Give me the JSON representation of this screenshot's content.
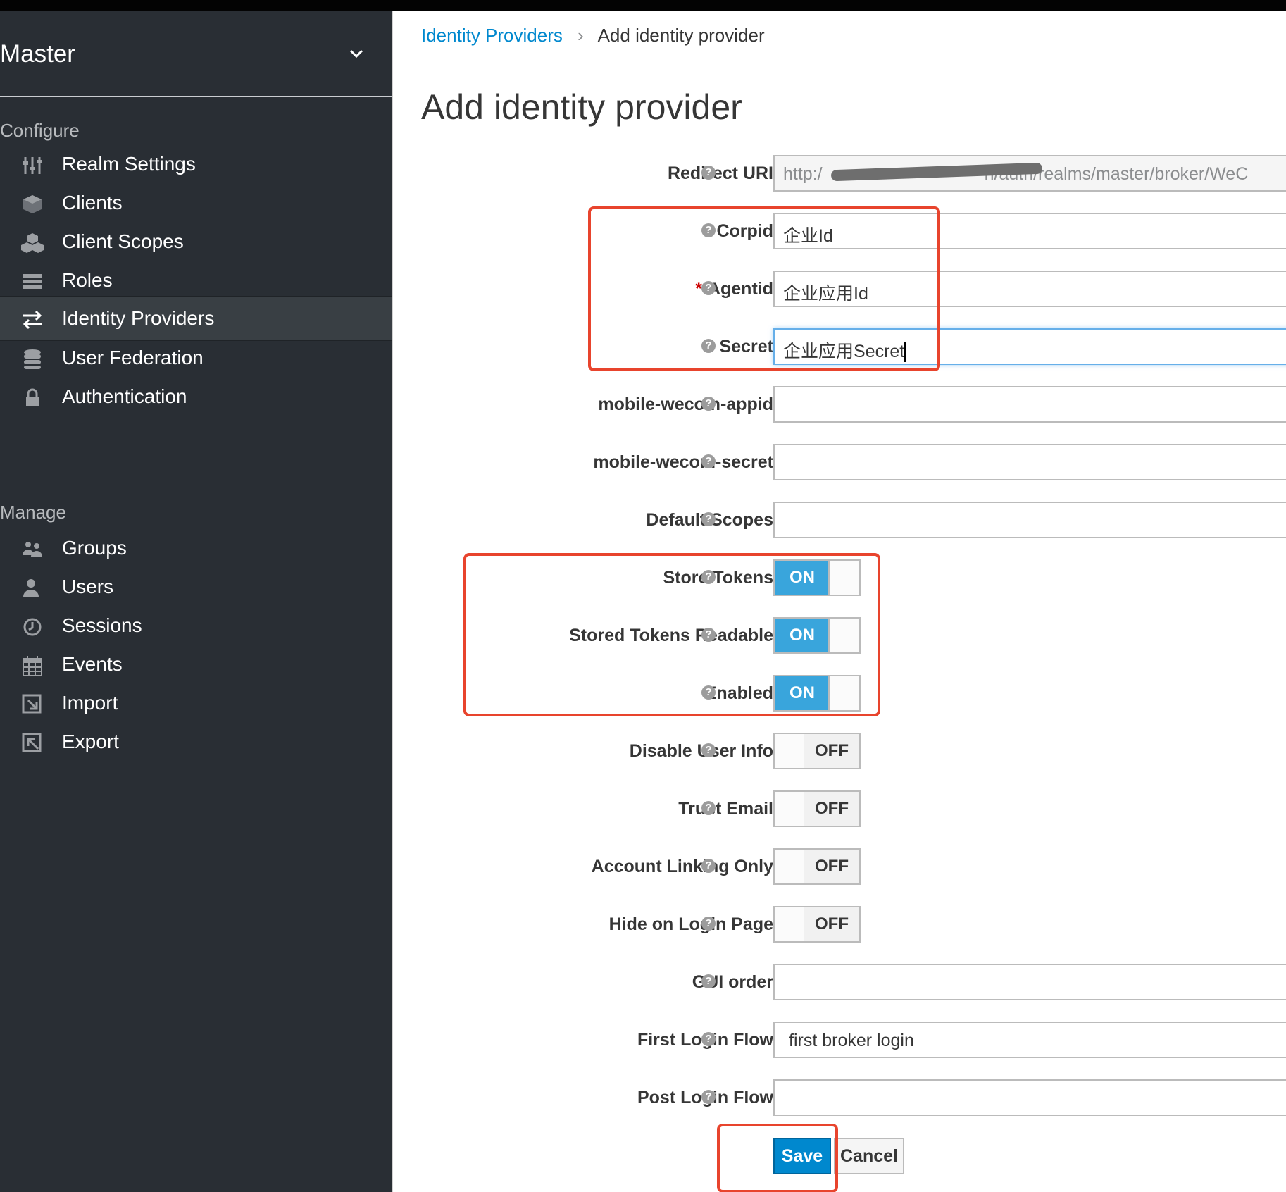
{
  "sidebar": {
    "realm": "Master",
    "sections": {
      "configure": "Configure",
      "manage": "Manage"
    },
    "configure_items": [
      {
        "label": "Realm Settings",
        "icon": "sliders-icon"
      },
      {
        "label": "Clients",
        "icon": "cube-icon"
      },
      {
        "label": "Client Scopes",
        "icon": "cubes-icon"
      },
      {
        "label": "Roles",
        "icon": "list-icon"
      },
      {
        "label": "Identity Providers",
        "icon": "exchange-icon",
        "active": true
      },
      {
        "label": "User Federation",
        "icon": "database-icon"
      },
      {
        "label": "Authentication",
        "icon": "lock-icon"
      }
    ],
    "manage_items": [
      {
        "label": "Groups",
        "icon": "users-icon"
      },
      {
        "label": "Users",
        "icon": "user-icon"
      },
      {
        "label": "Sessions",
        "icon": "clock-icon"
      },
      {
        "label": "Events",
        "icon": "calendar-icon"
      },
      {
        "label": "Import",
        "icon": "import-icon"
      },
      {
        "label": "Export",
        "icon": "export-icon"
      }
    ]
  },
  "breadcrumb": {
    "parent": "Identity Providers",
    "current": "Add identity provider"
  },
  "page_title": "Add identity provider",
  "form": {
    "redirect_uri": {
      "label": "Redirect URI",
      "value_prefix": "http:/",
      "value_suffix": "n/auth/realms/master/broker/WeC"
    },
    "corpid": {
      "label": "Corpid",
      "value": "企业Id",
      "required": true
    },
    "agentid": {
      "label": "Agentid",
      "value": "企业应用Id",
      "required": true
    },
    "secret": {
      "label": "Secret",
      "value": "企业应用Secret",
      "required": true
    },
    "mobile_wecom_appid": {
      "label": "mobile-wecom-appid",
      "value": ""
    },
    "mobile_wecom_secret": {
      "label": "mobile-wecom-secret",
      "value": ""
    },
    "default_scopes": {
      "label": "Default Scopes",
      "value": ""
    },
    "store_tokens": {
      "label": "Store Tokens",
      "state": "ON"
    },
    "stored_tokens_readable": {
      "label": "Stored Tokens Readable",
      "state": "ON"
    },
    "enabled": {
      "label": "Enabled",
      "state": "ON"
    },
    "disable_user_info": {
      "label": "Disable User Info",
      "state": "OFF"
    },
    "trust_email": {
      "label": "Trust Email",
      "state": "OFF"
    },
    "account_linking_only": {
      "label": "Account Linking Only",
      "state": "OFF"
    },
    "hide_on_login_page": {
      "label": "Hide on Login Page",
      "state": "OFF"
    },
    "gui_order": {
      "label": "GUI order",
      "value": ""
    },
    "first_login_flow": {
      "label": "First Login Flow",
      "value": "first broker login"
    },
    "post_login_flow": {
      "label": "Post Login Flow",
      "value": ""
    },
    "help_glyph": "?"
  },
  "buttons": {
    "save": "Save",
    "cancel": "Cancel"
  },
  "colors": {
    "highlight": "#e8442d",
    "switch_on": "#39a5dc",
    "link": "#0088ce",
    "sidebar": "#292e34"
  }
}
